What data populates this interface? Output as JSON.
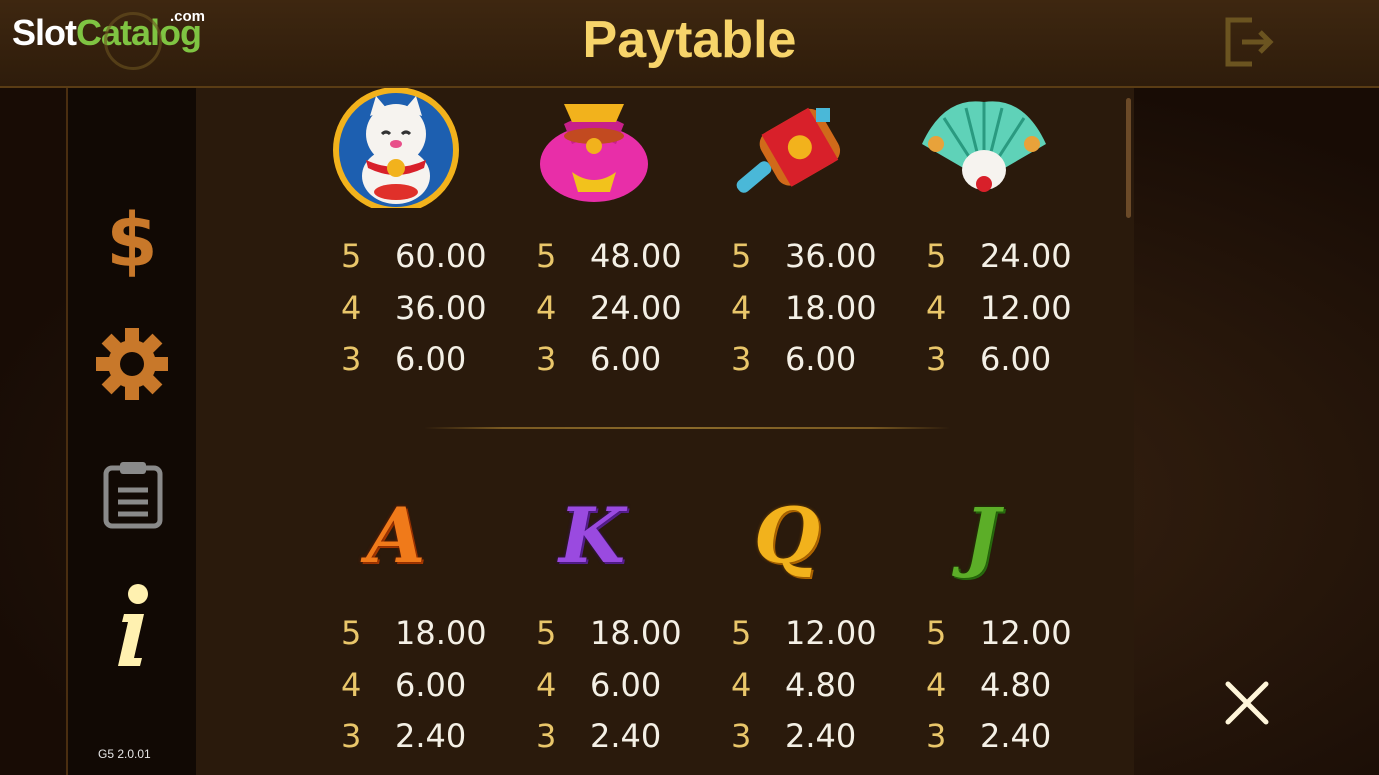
{
  "header": {
    "title": "Paytable",
    "exit_icon": "exit-icon"
  },
  "logo": {
    "part1": "Slot",
    "part2": "Catalog",
    "suffix": ".com"
  },
  "sidebar": {
    "items": [
      {
        "name": "dollar-icon",
        "color": "#c8782a"
      },
      {
        "name": "gear-icon",
        "color": "#c8782a"
      },
      {
        "name": "clipboard-icon",
        "color": "#8a8a8a"
      },
      {
        "name": "info-icon",
        "color": "#fff1b0"
      }
    ],
    "version": "G5 2.0.01"
  },
  "symbols_top": [
    {
      "name": "lucky-cat-icon",
      "pays": [
        {
          "count": "5",
          "value": "60.00"
        },
        {
          "count": "4",
          "value": "36.00"
        },
        {
          "count": "3",
          "value": "6.00"
        }
      ]
    },
    {
      "name": "money-bag-icon",
      "pays": [
        {
          "count": "5",
          "value": "48.00"
        },
        {
          "count": "4",
          "value": "24.00"
        },
        {
          "count": "3",
          "value": "6.00"
        }
      ]
    },
    {
      "name": "mallet-icon",
      "pays": [
        {
          "count": "5",
          "value": "36.00"
        },
        {
          "count": "4",
          "value": "18.00"
        },
        {
          "count": "3",
          "value": "6.00"
        }
      ]
    },
    {
      "name": "fan-icon",
      "pays": [
        {
          "count": "5",
          "value": "24.00"
        },
        {
          "count": "4",
          "value": "12.00"
        },
        {
          "count": "3",
          "value": "6.00"
        }
      ]
    }
  ],
  "symbols_bottom": [
    {
      "letter": "A",
      "color": "#f07a1a",
      "pays": [
        {
          "count": "5",
          "value": "18.00"
        },
        {
          "count": "4",
          "value": "6.00"
        },
        {
          "count": "3",
          "value": "2.40"
        }
      ]
    },
    {
      "letter": "K",
      "color": "#9a4ae0",
      "pays": [
        {
          "count": "5",
          "value": "18.00"
        },
        {
          "count": "4",
          "value": "6.00"
        },
        {
          "count": "3",
          "value": "2.40"
        }
      ]
    },
    {
      "letter": "Q",
      "color": "#f2b21c",
      "pays": [
        {
          "count": "5",
          "value": "12.00"
        },
        {
          "count": "4",
          "value": "4.80"
        },
        {
          "count": "3",
          "value": "2.40"
        }
      ]
    },
    {
      "letter": "J",
      "color": "#5cae28",
      "pays": [
        {
          "count": "5",
          "value": "12.00"
        },
        {
          "count": "4",
          "value": "4.80"
        },
        {
          "count": "3",
          "value": "2.40"
        }
      ]
    }
  ],
  "close_icon": "close-icon"
}
